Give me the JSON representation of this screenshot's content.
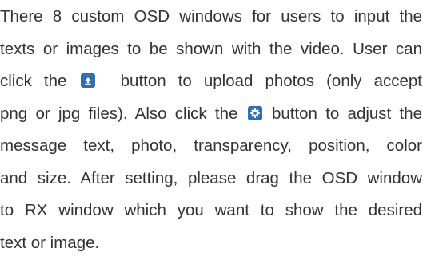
{
  "paragraph": {
    "line1": "There 8 custom OSD windows for users to input the",
    "line2": "texts or images to be shown with the video. User can",
    "line3_a": "click the",
    "line3_b": "button to upload photos (only accept",
    "line4_a": "png or jpg files). Also click the",
    "line4_b": "button to adjust the",
    "line5": "message text, photo, transparency, position, color",
    "line6": "and size. After setting, please drag the OSD window",
    "line7": "to RX window which you want to show the desired",
    "line8": "text or image."
  },
  "icons": {
    "upload": "upload-icon",
    "settings": "gear-icon",
    "color": "#2f6fb1"
  }
}
